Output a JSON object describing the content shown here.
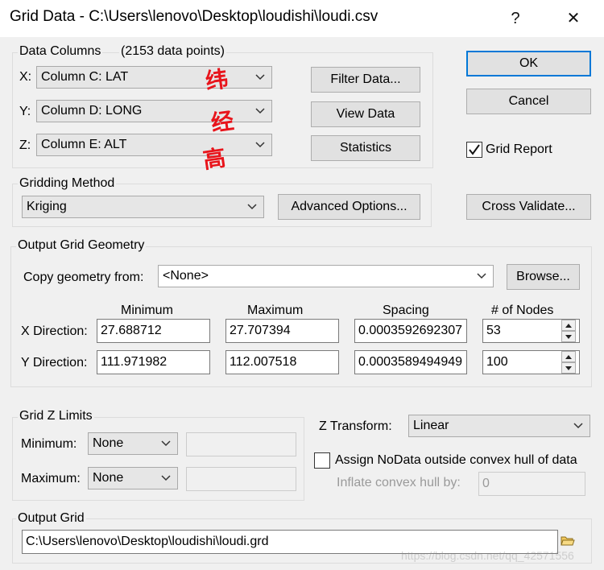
{
  "window": {
    "title": "Grid Data - C:\\Users\\lenovo\\Desktop\\loudishi\\loudi.csv",
    "help_glyph": "?",
    "close_glyph": "✕"
  },
  "data_columns": {
    "label": "Data Columns",
    "count": "(2153 data points)",
    "x_label": "X:",
    "x_value": "Column C:  LAT",
    "y_label": "Y:",
    "y_value": "Column D:  LONG",
    "z_label": "Z:",
    "z_value": "Column E:  ALT",
    "annotations": [
      "纬",
      "经",
      "高"
    ]
  },
  "buttons": {
    "filter": "Filter Data...",
    "view": "View Data",
    "statistics": "Statistics",
    "ok": "OK",
    "cancel": "Cancel",
    "cross_validate": "Cross Validate...",
    "advanced": "Advanced Options...",
    "browse": "Browse..."
  },
  "grid_report": {
    "label": "Grid Report",
    "checked": true
  },
  "gridding_method": {
    "label": "Gridding Method",
    "value": "Kriging"
  },
  "geometry": {
    "label": "Output Grid Geometry",
    "copy_label": "Copy geometry from:",
    "copy_value": "<None>",
    "headers": {
      "min": "Minimum",
      "max": "Maximum",
      "spacing": "Spacing",
      "nodes": "# of Nodes"
    },
    "x": {
      "label": "X Direction:",
      "min": "27.688712",
      "max": "27.707394",
      "spacing": "0.0003592692307",
      "nodes": "53"
    },
    "y": {
      "label": "Y Direction:",
      "min": "111.971982",
      "max": "112.007518",
      "spacing": "0.0003589494949",
      "nodes": "100"
    }
  },
  "zlimits": {
    "label": "Grid Z Limits",
    "min_label": "Minimum:",
    "min_value": "None",
    "max_label": "Maximum:",
    "max_value": "None"
  },
  "ztransform": {
    "label": "Z Transform:",
    "value": "Linear"
  },
  "nodata": {
    "label": "Assign NoData outside convex hull of data",
    "checked": false,
    "inflate_label": "Inflate convex hull by:",
    "inflate_value": "0"
  },
  "output": {
    "label": "Output Grid",
    "path": "C:\\Users\\lenovo\\Desktop\\loudishi\\loudi.grd"
  },
  "watermark": "https://blog.csdn.net/qq_42571556"
}
